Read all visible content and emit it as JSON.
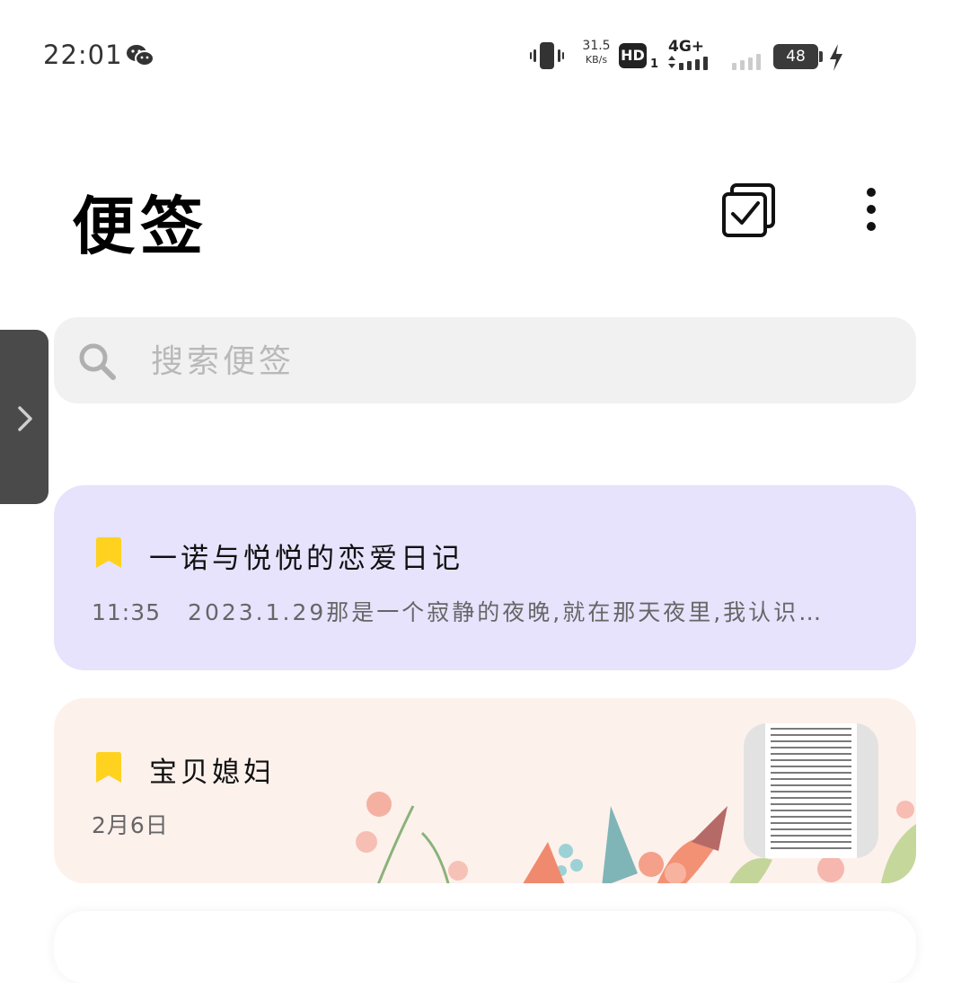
{
  "status_bar": {
    "time": "22:01",
    "net_speed_value": "31.5",
    "net_speed_unit": "KB/s",
    "hd_label": "HD",
    "hd_sub": "1",
    "network_type": "4G+",
    "battery_level": "48",
    "icons": [
      "wechat-icon",
      "vibrate-icon",
      "signal-icon",
      "battery-icon",
      "charging-icon"
    ]
  },
  "header": {
    "title": "便签",
    "icons": [
      "multi-select-icon",
      "more-vertical-icon"
    ]
  },
  "search": {
    "placeholder": "搜索便签"
  },
  "notes": [
    {
      "title": "一诺与悦悦的恋爱日记",
      "time": "11:35",
      "preview": "2023.1.29那是一个寂静的夜晚,就在那天夜里,我认识…",
      "color": "#e7e3fd"
    },
    {
      "title": "宝贝媳妇",
      "time": "2月6日",
      "color": "#fdf1ec"
    }
  ],
  "colors": {
    "bookmark": "#ffd21f",
    "search_bg": "#f1f1f1",
    "drawer_handle": "#4a4a4a"
  }
}
